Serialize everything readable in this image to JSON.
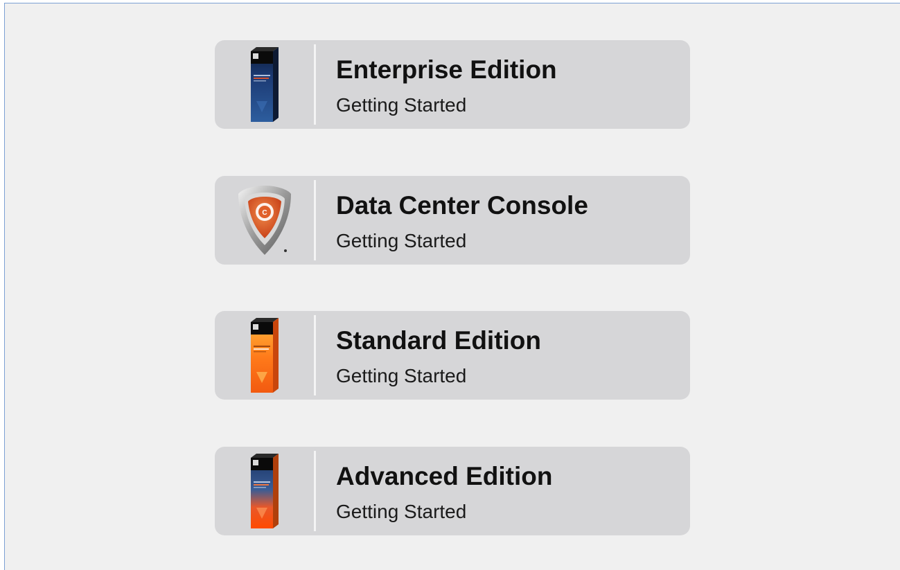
{
  "products": [
    {
      "title": "Enterprise Edition",
      "subtitle": "Getting Started",
      "icon": "product-box-blue-icon",
      "box_colors": [
        "#1c3a73",
        "#2b5aa0"
      ]
    },
    {
      "title": "Data Center Console",
      "subtitle": "Getting Started",
      "icon": "shield-logo-icon",
      "box_colors": [
        "#e65b1c",
        "#f08a4a"
      ]
    },
    {
      "title": "Standard Edition",
      "subtitle": "Getting Started",
      "icon": "product-box-orange-icon",
      "box_colors": [
        "#ff7a1a",
        "#ff9a2a"
      ]
    },
    {
      "title": "Advanced Edition",
      "subtitle": "Getting Started",
      "icon": "product-box-blue-orange-icon",
      "box_colors": [
        "#1f4a8a",
        "#ff5a10"
      ]
    }
  ]
}
